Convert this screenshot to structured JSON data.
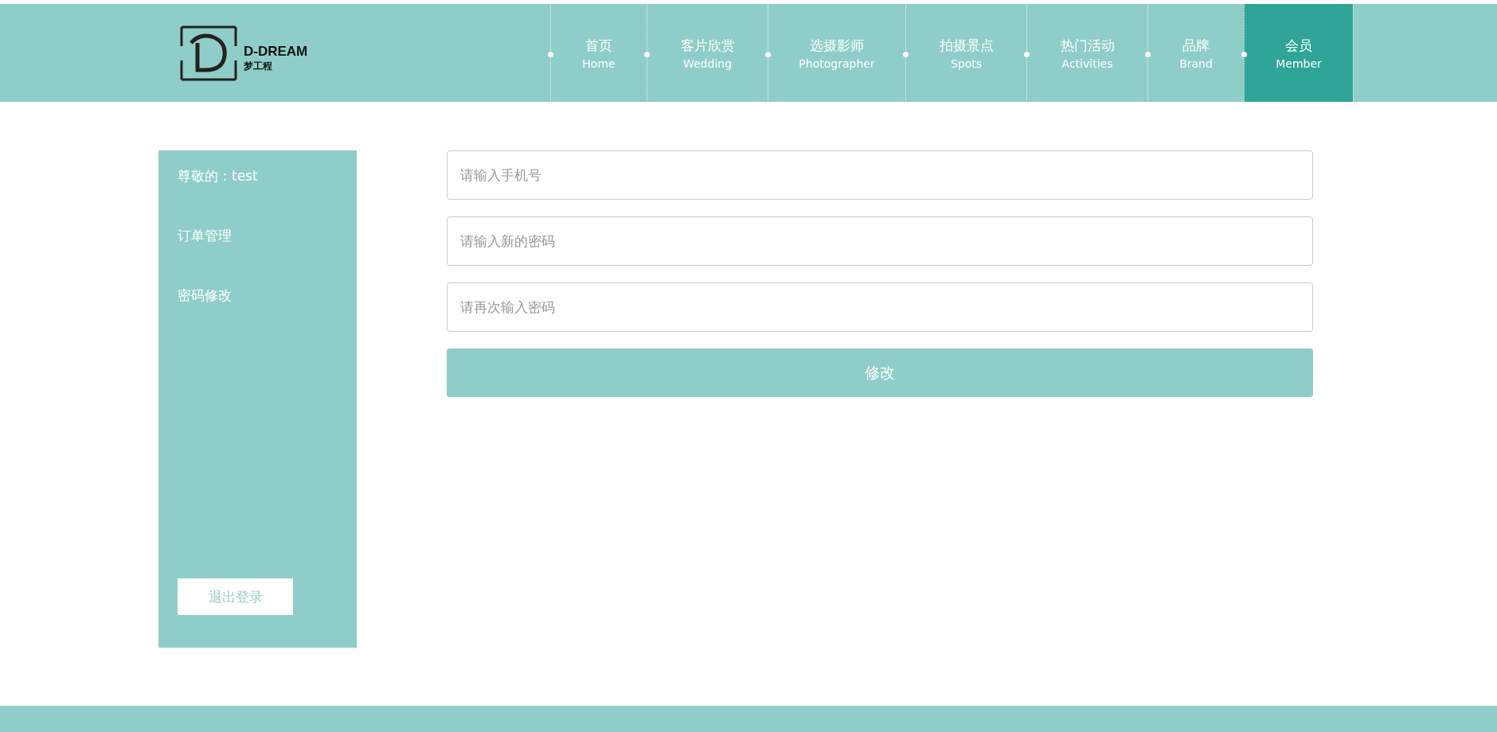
{
  "logo": {
    "name": "D-DREAM",
    "subtitle": "梦工程"
  },
  "nav": [
    {
      "label": "首页",
      "sub": "Home",
      "selected": false
    },
    {
      "label": "客片欣赏",
      "sub": "Wedding",
      "selected": false
    },
    {
      "label": "选摄影师",
      "sub": "Photographer",
      "selected": false
    },
    {
      "label": "拍摄景点",
      "sub": "Spots",
      "selected": false
    },
    {
      "label": "热门活动",
      "sub": "Activities",
      "selected": false
    },
    {
      "label": "品牌",
      "sub": "Brand",
      "selected": false
    },
    {
      "label": "会员",
      "sub": "Member",
      "selected": true
    }
  ],
  "sidebar": {
    "greeting": "尊敬的：test",
    "items": [
      "订单管理",
      "密码修改"
    ],
    "logout": "退出登录"
  },
  "form": {
    "fields": [
      {
        "placeholder": "请输入手机号"
      },
      {
        "placeholder": "请输入新的密码"
      },
      {
        "placeholder": "请再次输入密码"
      }
    ],
    "submit": "修改"
  }
}
